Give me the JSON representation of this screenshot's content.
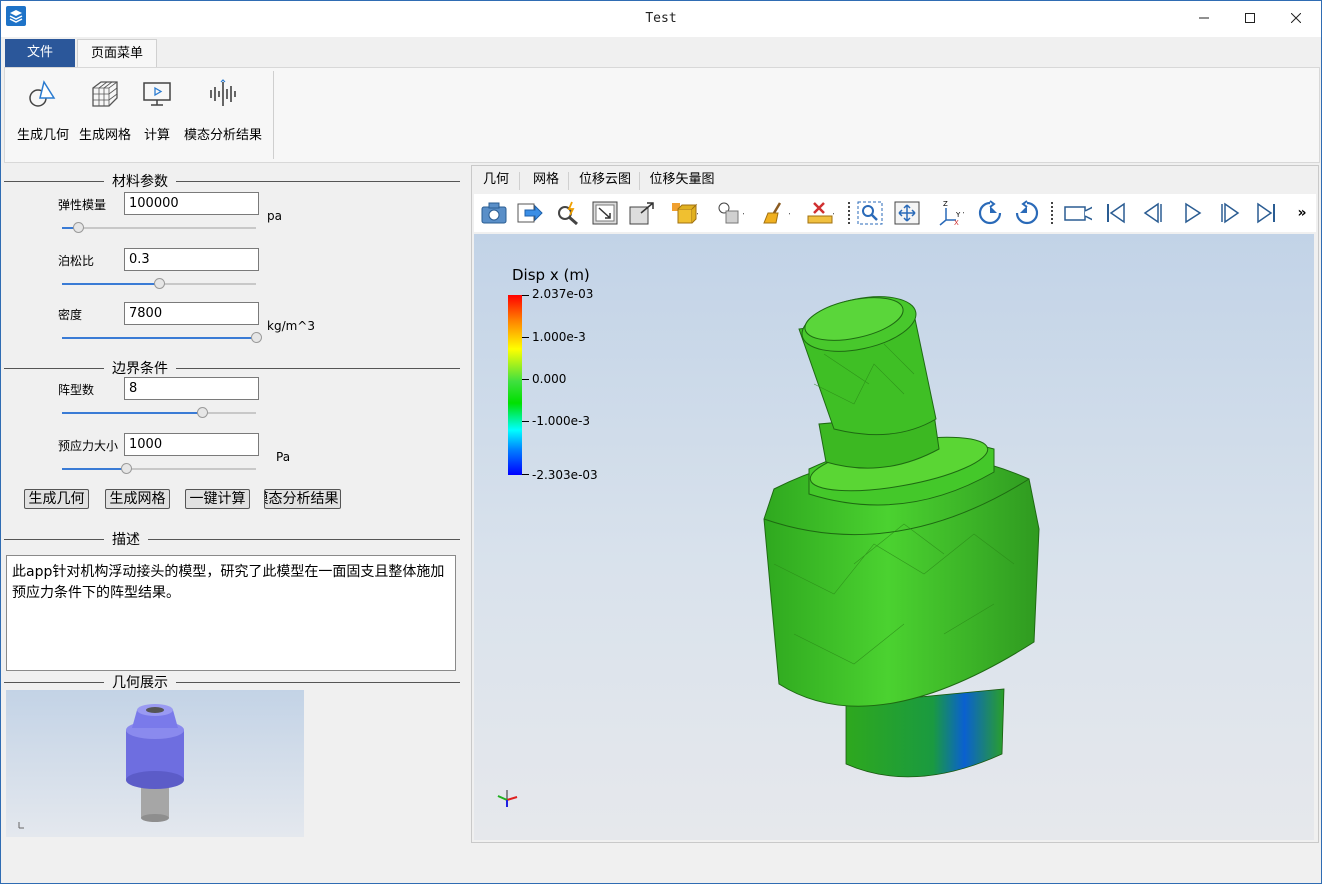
{
  "window": {
    "title": "Test"
  },
  "ribbon": {
    "tabs": [
      "文件",
      "页面菜单"
    ],
    "buttons": [
      "生成几何",
      "生成网格",
      "计算",
      "模态分析结果"
    ]
  },
  "material": {
    "section_title": "材料参数",
    "youngs": {
      "label": "弹性模量",
      "value": "100000",
      "unit": "pa",
      "slider": 0.08
    },
    "poisson": {
      "label": "泊松比",
      "value": "0.3",
      "slider": 0.5
    },
    "density": {
      "label": "密度",
      "value": "7800",
      "unit": "kg/m^3",
      "slider": 1.0
    }
  },
  "boundary": {
    "section_title": "边界条件",
    "modes": {
      "label": "阵型数",
      "value": "8",
      "slider": 0.72
    },
    "prestress": {
      "label": "预应力大小",
      "value": "1000",
      "unit": "Pa",
      "slider": 0.33
    }
  },
  "actions": [
    "生成几何",
    "生成网格",
    "一键计算",
    "模态分析结果"
  ],
  "description": {
    "section_title": "描述",
    "text": "此app针对机构浮动接头的模型，研究了此模型在一面固支且整体施加预应力条件下的阵型结果。"
  },
  "geometry": {
    "section_title": "几何展示"
  },
  "view_tabs": [
    "几何",
    "网格",
    "位移云图",
    "位移矢量图"
  ],
  "viewport": {
    "legend_title": "Disp x (m)",
    "legend_labels": [
      "2.037e-03",
      "1.000e-3",
      "0.000",
      "-1.000e-3",
      "-2.303e-03"
    ]
  },
  "colors": {
    "accent": "#2b579a",
    "model_green": "#3fcf2a",
    "geom_blue": "#7878e6"
  }
}
